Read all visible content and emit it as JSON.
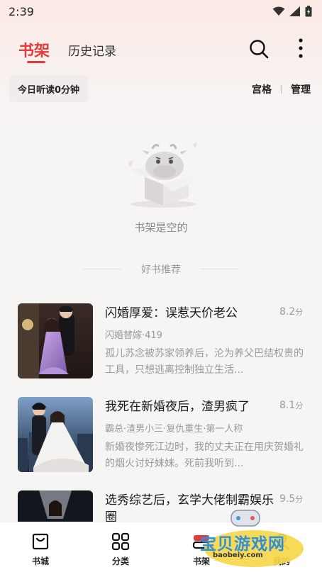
{
  "status_bar": {
    "time": "2:39"
  },
  "header": {
    "tabs": [
      {
        "label": "书架",
        "active": true
      },
      {
        "label": "历史记录",
        "active": false
      }
    ],
    "icons": [
      "search-icon",
      "more-vertical-icon"
    ]
  },
  "toolbar": {
    "reading_time": "今日听读0分钟",
    "view_label": "宫格",
    "manage_label": "管理"
  },
  "empty_state": {
    "text": "书架是空的"
  },
  "recommend": {
    "title": "好书推荐",
    "books": [
      {
        "title": "闪婚厚爱：误惹天价老公",
        "score": "8.2",
        "score_unit": "分",
        "tags": "闪婚替嫁·419",
        "desc": "孤儿苏念被苏家领养后，沦为养父巴结权贵的工具，只想逃离控制独立生活..."
      },
      {
        "title": "我死在新婚夜后，渣男疯了",
        "score": "8.1",
        "score_unit": "分",
        "tags": "霸总·渣男小三·复仇重生·第一人称",
        "desc": "新婚夜惨死江边时，我的丈夫正在用庆贺婚礼的烟火讨好妹妹。死前我听到..."
      },
      {
        "title": "选秀综艺后，玄学大佬制霸娱乐圈",
        "score": "9.5",
        "score_unit": "分"
      }
    ]
  },
  "bottom_nav": {
    "items": [
      {
        "label": "书城",
        "icon": "store-bag-icon"
      },
      {
        "label": "分类",
        "icon": "grid-icon"
      },
      {
        "label": "书架",
        "icon": "bookshelf-icon",
        "active": true
      },
      {
        "label": "我的",
        "icon": "profile-icon"
      }
    ]
  },
  "watermark": {
    "text": "宝贝游戏网",
    "url_text": "baobeiy.com"
  },
  "colors": {
    "accent": "#e13b3b",
    "background": "#f7f5f4",
    "muted": "#999999"
  }
}
